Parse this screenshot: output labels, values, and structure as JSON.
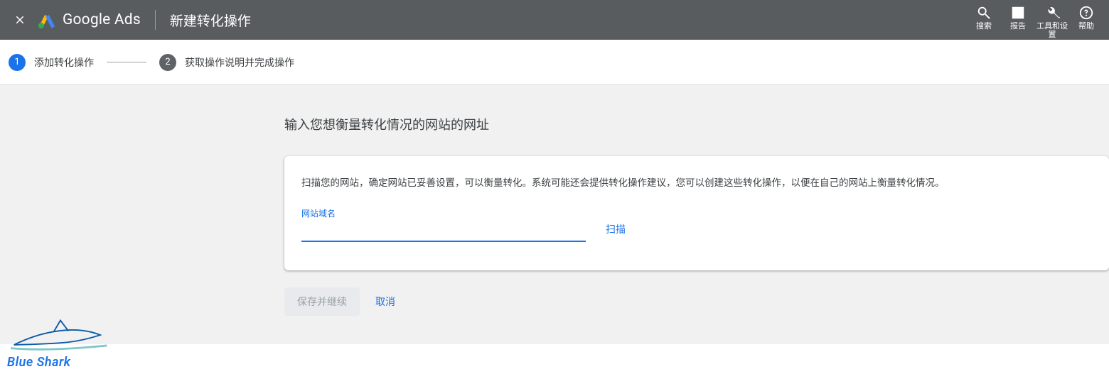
{
  "appbar": {
    "product": "Google Ads",
    "page_title": "新建转化操作",
    "actions": {
      "search": "搜索",
      "reports": "报告",
      "tools": "工具和设置",
      "help": "帮助"
    }
  },
  "stepper": {
    "step1": {
      "num": "1",
      "label": "添加转化操作"
    },
    "step2": {
      "num": "2",
      "label": "获取操作说明并完成操作"
    }
  },
  "section": {
    "heading": "输入您想衡量转化情况的网站的网址",
    "card_desc": "扫描您的网站，确定网站已妥善设置，可以衡量转化。系统可能还会提供转化操作建议，您可以创建这些转化操作，以便在自己的网站上衡量转化情况。",
    "input_label": "网站域名",
    "input_value": "",
    "scan": "扫描",
    "save": "保存并继续",
    "cancel": "取消"
  },
  "watermark": {
    "text": "Blue Shark"
  }
}
